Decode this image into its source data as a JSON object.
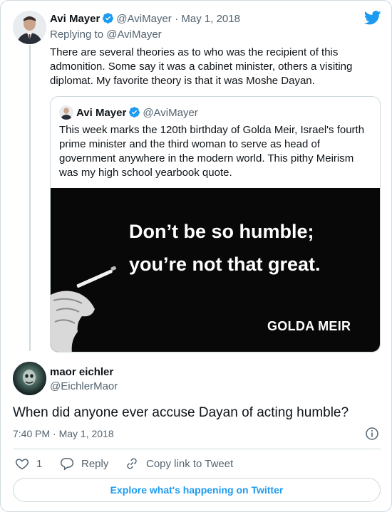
{
  "colors": {
    "brand": "#1d9bf0",
    "text": "#0f1419",
    "muted": "#536471",
    "border": "#cfd9de"
  },
  "tweet1": {
    "name": "Avi Mayer",
    "handle": "@AviMayer",
    "date": "· May 1, 2018",
    "replying_to": "Replying to @AviMayer",
    "text_lines": [
      "There are several theories as to who was the recipient of this",
      "admonition. Some say it was a cabinet minister, others a visiting",
      "diplomat. My favorite theory is that it was Moshe Dayan."
    ]
  },
  "quote": {
    "name": "Avi Mayer",
    "handle": "@AviMayer",
    "text_lines": [
      "This week marks the 120th birthday of Golda Meir, Israel's fourth",
      "prime minister and the third woman to serve as head of",
      "government anywhere in the modern world. This pithy Meirism",
      "was my high school yearbook quote."
    ],
    "image": {
      "line1": "Don’t be so humble;",
      "line2": "you’re not that great.",
      "attribution": "GOLDA MEIR"
    }
  },
  "tweet2": {
    "name": "maor eichler",
    "handle": "@EichlerMaor",
    "text": "When did anyone ever accuse Dayan of acting humble?",
    "timestamp": "7:40 PM · May 1, 2018"
  },
  "actions": {
    "like_count": "1",
    "reply_label": "Reply",
    "copy_label": "Copy link to Tweet"
  },
  "explore_label": "Explore what's happening on Twitter",
  "icons": [
    "twitter-bird-icon",
    "verified-badge-icon",
    "info-icon",
    "heart-icon",
    "reply-icon",
    "link-icon"
  ]
}
